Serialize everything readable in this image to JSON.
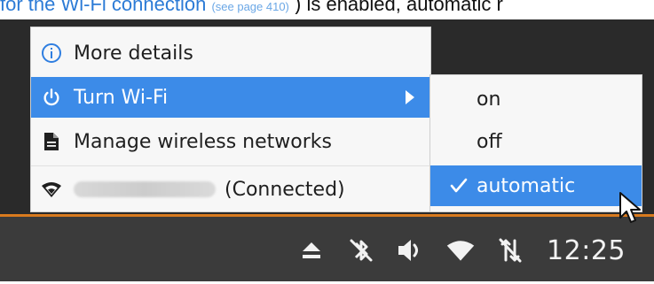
{
  "doc_line": {
    "link_text": "for the Wi-Fi connection",
    "small_text": "(see page 410)",
    "trailing_text": ") is enabled, automatic r"
  },
  "menu": {
    "items": [
      {
        "label": "More details",
        "icon": "info-icon"
      },
      {
        "label": "Turn Wi-Fi",
        "icon": "power-icon",
        "selected": true,
        "has_submenu": true
      },
      {
        "label": "Manage wireless networks",
        "icon": "document-icon"
      },
      {
        "label": "(Connected)",
        "icon": "wifi-icon",
        "ssid_blurred": true
      }
    ]
  },
  "submenu": {
    "items": [
      {
        "label": "on"
      },
      {
        "label": "off"
      },
      {
        "label": "automatic",
        "checked": true,
        "selected": true
      }
    ]
  },
  "panel": {
    "clock": "12:25",
    "tray_icons": [
      "eject-icon",
      "bluetooth-disabled-icon",
      "volume-icon",
      "wifi-icon",
      "network-disabled-icon"
    ]
  },
  "colors": {
    "selection": "#3c8be8",
    "panel_bg": "#3b3b3b",
    "panel_border": "#d97a1e",
    "menu_bg": "#f7f7f7"
  }
}
